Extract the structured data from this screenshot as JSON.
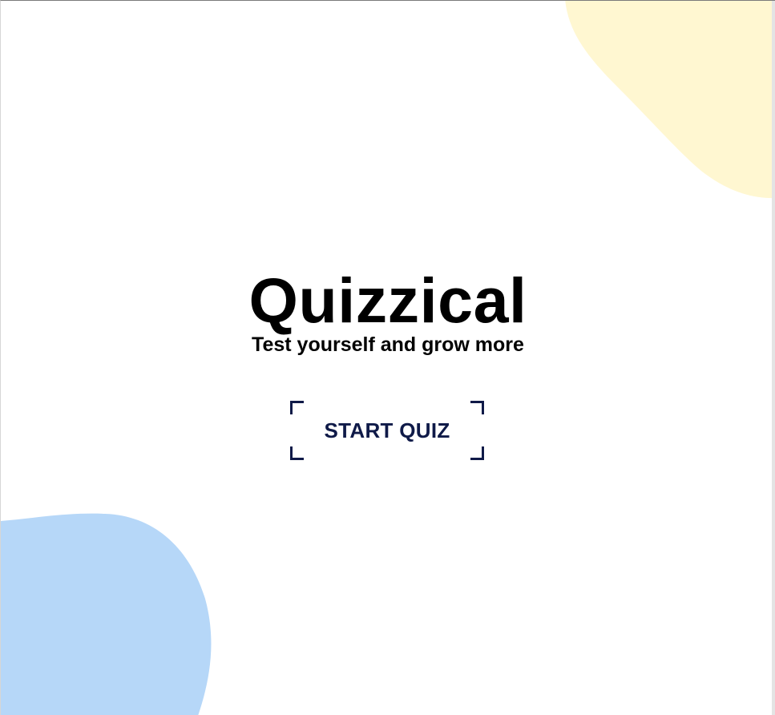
{
  "app": {
    "title": "Quizzical",
    "tagline": "Test yourself and grow more",
    "start_button_label": "START QUIZ"
  },
  "colors": {
    "background": "#ffffff",
    "blob_yellow": "#fff7d1",
    "blob_blue": "#b6d7f8",
    "button_text": "#0f1a48",
    "title_text": "#000000"
  }
}
